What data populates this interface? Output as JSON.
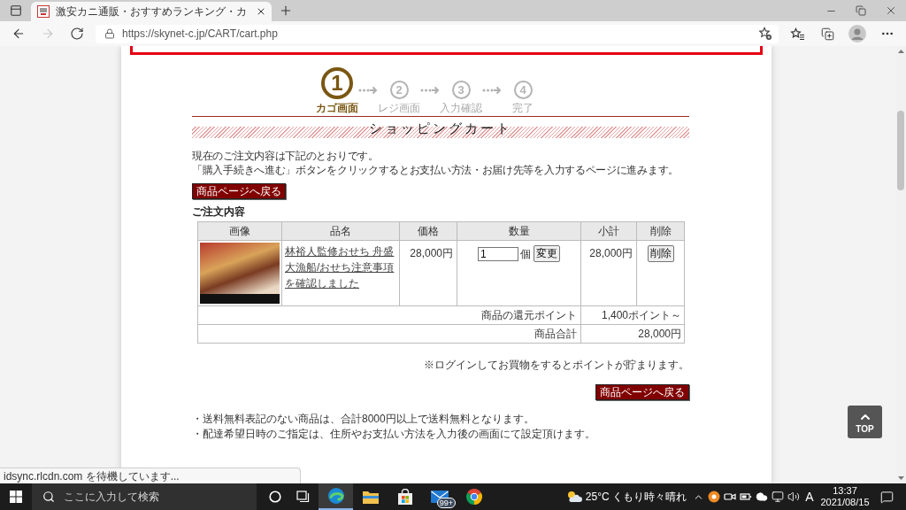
{
  "browser": {
    "tab": {
      "title": "激安カニ通販・おすすめランキング・カ"
    },
    "nav": [
      {
        "kind": "back",
        "disabled": false
      },
      {
        "kind": "forward",
        "disabled": true
      },
      {
        "kind": "refresh",
        "disabled": false
      }
    ],
    "url": "https://skynet-c.jp/CART/cart.php"
  },
  "steps": [
    {
      "number": "1",
      "label": "カゴ画面",
      "selected": true
    },
    {
      "number": "2",
      "label": "レジ画面",
      "selected": false
    },
    {
      "number": "3",
      "label": "入力確認",
      "selected": false
    },
    {
      "number": "4",
      "label": "完了",
      "selected": false
    }
  ],
  "section_title": "ショッピングカート",
  "intro": [
    "現在のご注文内容は下記のとおりです。",
    "「購入手続きへ進む」ボタンをクリックするとお支払い方法・お届け先等を入力するページに進みます。"
  ],
  "back_button_top": "商品ページへ戻る",
  "order_heading": "ご注文内容",
  "table": {
    "columns": [
      "画像",
      "品名",
      "価格",
      "数量",
      "小計",
      "削除"
    ],
    "rows": [
      {
        "product": "林裕人監修おせち 舟盛大漁船/おせち注意事項を確認しました",
        "price": "28,000円",
        "quantity": "1",
        "unit": "個",
        "update_button": "変更",
        "subtotal": "28,000円",
        "delete_button": "削除"
      }
    ],
    "summary": [
      {
        "label": "商品の還元ポイント",
        "value": "1,400ポイント～"
      },
      {
        "label": "商品合計",
        "value": "28,000円"
      }
    ]
  },
  "login_note": "※ログインしてお買物をするとポイントが貯まります。",
  "back_button_bottom": "商品ページへ戻る",
  "notes": [
    "・送料無料表記のない商品は、合計8000円以上で送料無料となります。",
    "・配達希望日時のご指定は、住所やお支払い方法を入力後の画面にて設定頂けます。"
  ],
  "top_button": "TOP",
  "status_text": "idsync.rlcdn.com を待機しています...",
  "taskbar": {
    "search_placeholder": "ここに入力して検索",
    "apps": [
      {
        "kind": "cortana",
        "selected": false
      },
      {
        "kind": "task-view",
        "selected": false
      },
      {
        "kind": "edge",
        "selected": true
      },
      {
        "kind": "explorer",
        "selected": false
      },
      {
        "kind": "store",
        "selected": false
      },
      {
        "kind": "mail",
        "selected": false,
        "badge": "99+"
      },
      {
        "kind": "chrome",
        "selected": false
      }
    ],
    "weather": "25°C くもり時々晴れ",
    "ime": "A",
    "time": "13:37",
    "date": "2021/08/15"
  }
}
